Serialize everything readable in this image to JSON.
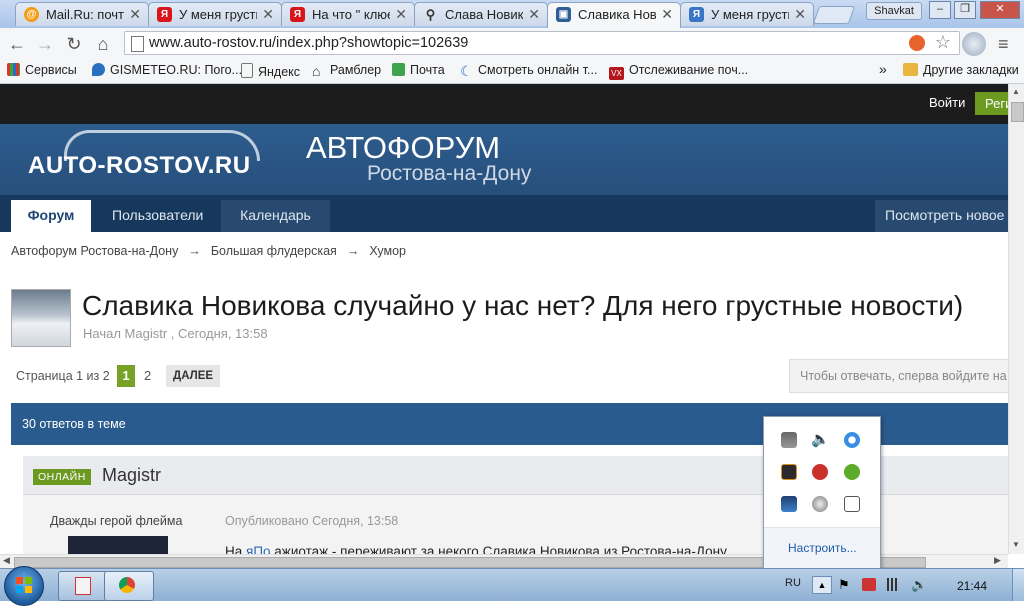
{
  "browser": {
    "tabs": [
      {
        "label": "Mail.Ru: почта",
        "icon": "mailru-icon",
        "color": "#f39c12"
      },
      {
        "label": "У меня грустн",
        "icon": "yandex-icon",
        "color": "#d9141b"
      },
      {
        "label": "На что \" клюет",
        "icon": "yandex-icon",
        "color": "#d9141b"
      },
      {
        "label": "Слава Новико",
        "icon": "search-icon",
        "color": "#555555"
      },
      {
        "label": "Славика Нови",
        "icon": "forum-icon",
        "color": "#2e5e96"
      },
      {
        "label": "У меня грустн",
        "icon": "yandex-icon",
        "color": "#3a76c8"
      }
    ],
    "user_badge": "Shavkat",
    "url": "www.auto-rostov.ru/index.php?showtopic=102639",
    "bookmarks": [
      {
        "label": "Сервисы",
        "icon": "apps-icon"
      },
      {
        "label": "GISMETEO.RU: Пого...",
        "icon": "gismeteo-icon"
      },
      {
        "label": "Яндекс",
        "icon": "page-icon"
      },
      {
        "label": "Рамблер",
        "icon": "home-icon"
      },
      {
        "label": "Почта",
        "icon": "mail-icon"
      },
      {
        "label": "Смотреть онлайн т...",
        "icon": "moon-icon"
      },
      {
        "label": "Отслеживание поч...",
        "icon": "vx-icon"
      }
    ],
    "bookmarks_more": "»",
    "other_bookmarks": "Другие закладки"
  },
  "site": {
    "login": "Войти",
    "register": "Регистрация",
    "logo": "AUTO-ROSTOV.RU",
    "title": "АВТОФОРУМ",
    "subtitle": "Ростова-на-Дону",
    "nav": [
      "Форум",
      "Пользователи",
      "Календарь"
    ],
    "nav_right": "Посмотреть новое",
    "breadcrumb": [
      "Автофорум Ростова-на-Дону",
      "Большая флудерская",
      "Хумор"
    ],
    "breadcrumb_sep": "→"
  },
  "topic": {
    "title": "Славика Новикова случайно у нас нет? Для него грустные новости)",
    "meta": "Начал Magistr , Сегодня, 13:58",
    "pagination_label": "Страница 1 из 2",
    "pages": [
      "1",
      "2"
    ],
    "next": "ДАЛЕЕ",
    "reply_prompt": "Чтобы отвечать, сперва войдите на форум",
    "replies": "30 ответов в теме"
  },
  "post": {
    "online": "ОНЛАЙН",
    "author": "Magistr",
    "rank": "Дважды герой флейма",
    "date": "Опубликовано Сегодня, 13:58",
    "text_before": "На ",
    "text_link": "яПо",
    "text_after": " ажиотаж - переживают за некого Славика Новикова из Ростова-на-Дону"
  },
  "tray": {
    "settings": "Настроить...",
    "language": "RU",
    "clock": "21:44"
  }
}
